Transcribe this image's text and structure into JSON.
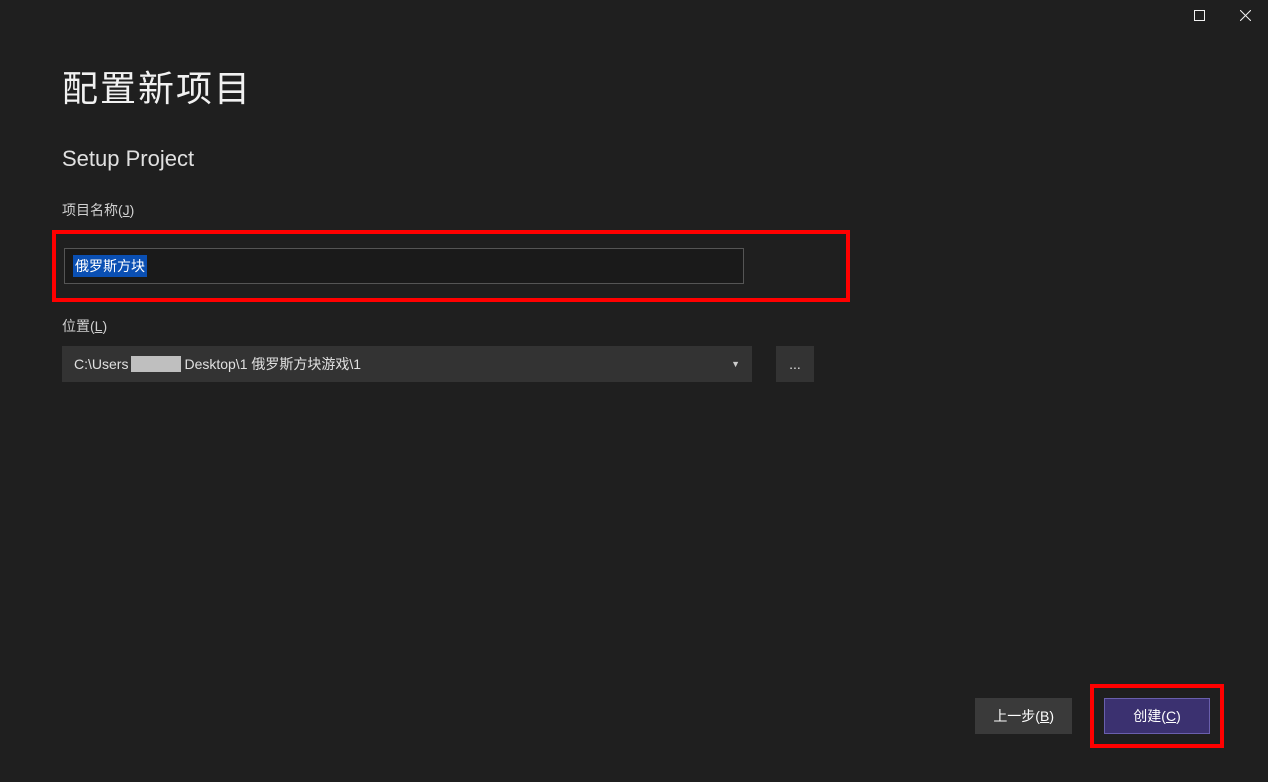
{
  "window": {
    "maximize_icon": "maximize",
    "close_icon": "close"
  },
  "heading": "配置新项目",
  "subheading": "Setup Project",
  "fields": {
    "project_name": {
      "label_prefix": "项目名称(",
      "label_hotkey": "J",
      "label_suffix": ")",
      "value": "俄罗斯方块"
    },
    "location": {
      "label_prefix": "位置(",
      "label_hotkey": "L",
      "label_suffix": ")",
      "path_prefix": "C:\\Users",
      "path_suffix": "Desktop\\1 俄罗斯方块游戏\\1",
      "browse_label": "..."
    }
  },
  "footer": {
    "back_prefix": "上一步(",
    "back_hotkey": "B",
    "back_suffix": ")",
    "create_prefix": "创建(",
    "create_hotkey": "C",
    "create_suffix": ")"
  }
}
